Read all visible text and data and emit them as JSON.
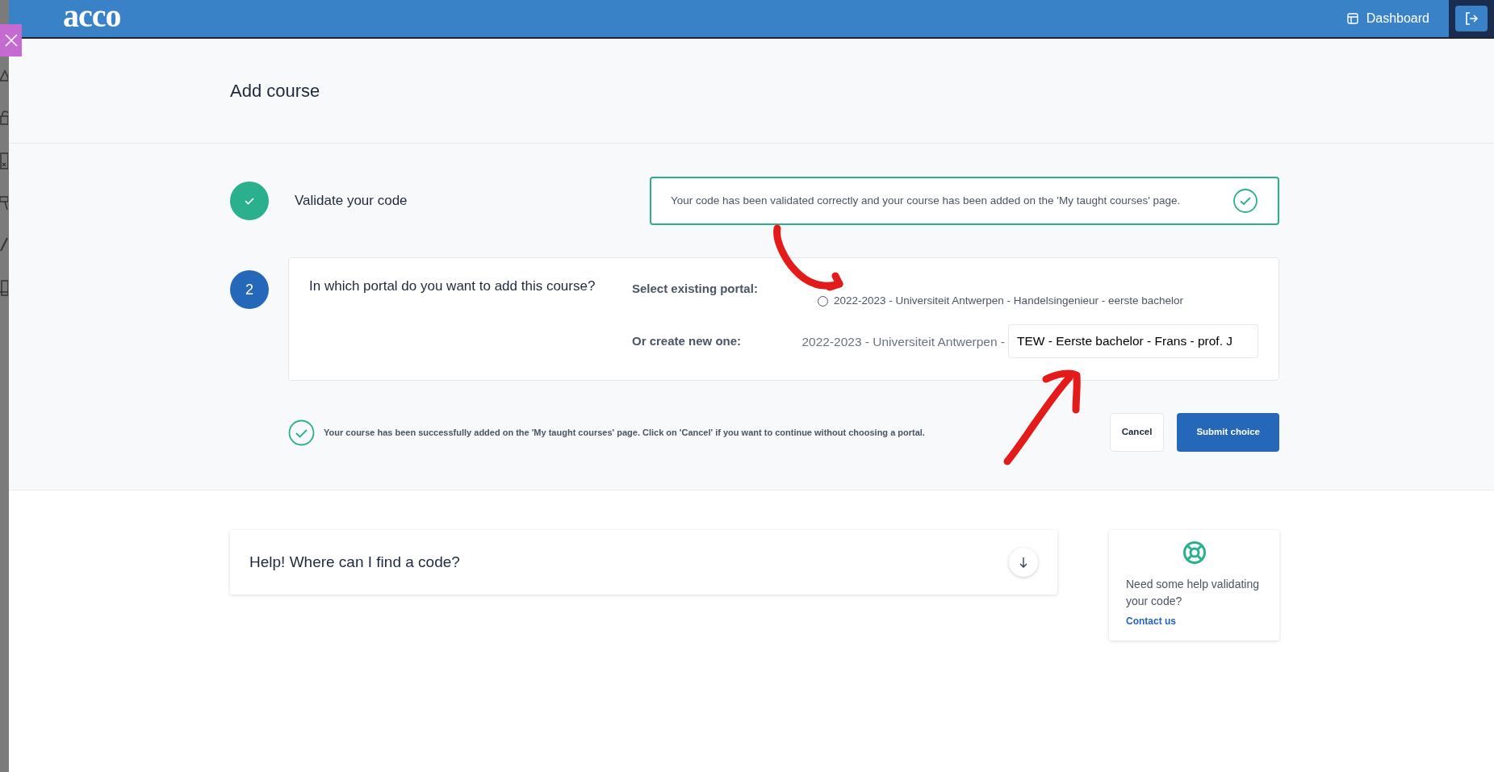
{
  "header": {
    "logo": "acco",
    "nav": [
      {
        "label": "Dashboard"
      }
    ]
  },
  "page_title": "Add course",
  "step_one": {
    "done": true,
    "title": "Validate your code",
    "message": "Your code has been validated correctly and your course has been added on the 'My taught courses' page."
  },
  "step_two": {
    "badge": "2",
    "title": "In which portal do you want to add this course?",
    "existing_label": "Select existing portal:",
    "options": [
      {
        "label": "2022-2023 - Universiteit Antwerpen - Handelsingenieur - eerste bachelor",
        "selected": false
      }
    ],
    "new_label": "Or create new one:",
    "new_prefix": "2022-2023 - Universiteit Antwerpen -",
    "new_value": "TEW - Eerste bachelor - Frans - prof. J"
  },
  "notice": "Your course has been successfully added on the 'My taught courses' page. Click on 'Cancel' if you want to continue without choosing a portal.",
  "buttons": [
    {
      "label": "Cancel",
      "kind": "secondary"
    },
    {
      "label": "Submit choice",
      "kind": "primary"
    }
  ],
  "help": {
    "title": "Help! Where can I find a code?",
    "expanded": false
  },
  "contact": {
    "text": "Need some help validating your code?",
    "link": "Contact us"
  }
}
